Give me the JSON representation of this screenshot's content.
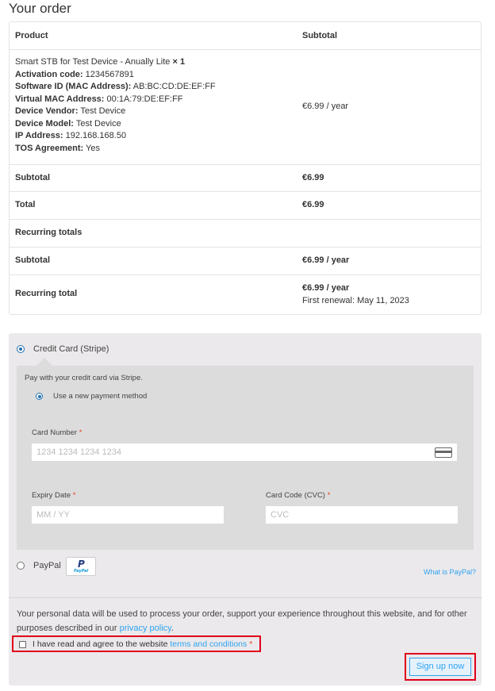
{
  "heading": "Your order",
  "table": {
    "header": {
      "product": "Product",
      "subtotal": "Subtotal"
    },
    "item": {
      "name": "Smart STB for Test Device - Anually Lite",
      "qty": "× 1",
      "meta": [
        {
          "label": "Activation code:",
          "value": "1234567891"
        },
        {
          "label": "Software ID (MAC Address):",
          "value": "AB:BC:CD:DE:EF:FF"
        },
        {
          "label": "Virtual MAC Address:",
          "value": "00:1A:79:DE:EF:FF"
        },
        {
          "label": "Device Vendor:",
          "value": "Test Device"
        },
        {
          "label": "Device Model:",
          "value": "Test Device"
        },
        {
          "label": "IP Address:",
          "value": "192.168.168.50"
        },
        {
          "label": "TOS Agreement:",
          "value": "Yes"
        }
      ],
      "price": "€6.99 / year"
    },
    "subtotal": {
      "label": "Subtotal",
      "value": "€6.99"
    },
    "total": {
      "label": "Total",
      "value": "€6.99"
    },
    "recurring_heading": "Recurring totals",
    "recurring_subtotal": {
      "label": "Subtotal",
      "value": "€6.99 / year"
    },
    "recurring_total": {
      "label": "Recurring total",
      "value": "€6.99 / year",
      "note": "First renewal: May 11, 2023"
    }
  },
  "payment": {
    "stripe": {
      "label": "Credit Card (Stripe)",
      "description": "Pay with your credit card via Stripe.",
      "new_method": "Use a new payment method",
      "card_number_label": "Card Number",
      "card_number_placeholder": "1234 1234 1234 1234",
      "expiry_label": "Expiry Date",
      "expiry_placeholder": "MM / YY",
      "cvc_label": "Card Code (CVC)",
      "cvc_placeholder": "CVC",
      "required_mark": "*"
    },
    "paypal": {
      "label": "PayPal",
      "logo_text": "PayPal",
      "what_is": "What is PayPal?"
    }
  },
  "privacy": {
    "text_before": "Your personal data will be used to process your order, support your experience throughout this website, and for other purposes described in our ",
    "link": "privacy policy",
    "text_after": "."
  },
  "terms": {
    "text": "I have read and agree to the website ",
    "link": "terms and conditions",
    "required_mark": "*"
  },
  "submit_label": "Sign up now",
  "colors": {
    "link": "#2ea3f2",
    "required": "#e2401c",
    "highlight_outline": "#e0001b",
    "panel_bg": "#ebe9eb"
  }
}
